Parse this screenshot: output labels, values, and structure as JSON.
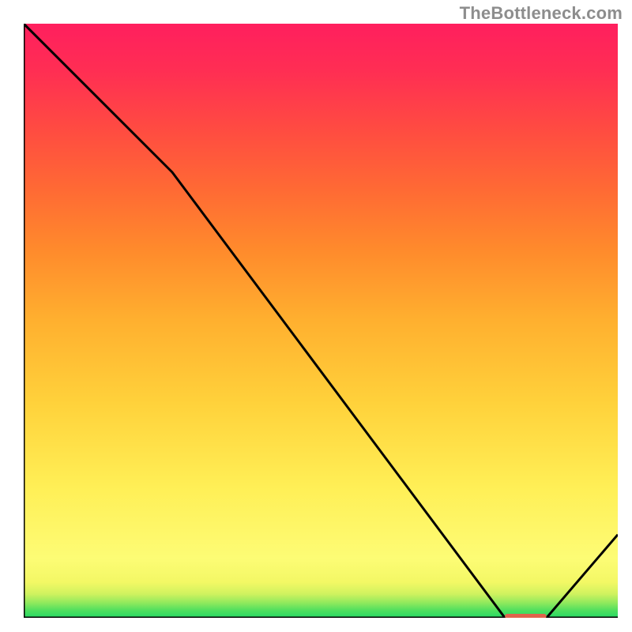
{
  "watermark_text": "TheBottleneck.com",
  "chart_data": {
    "type": "line",
    "title": "",
    "xlabel": "",
    "ylabel": "",
    "xlim": [
      0,
      100
    ],
    "ylim": [
      0,
      100
    ],
    "series": [
      {
        "name": "curve",
        "x": [
          0,
          25,
          81,
          88,
          100
        ],
        "y": [
          100,
          75,
          0,
          0,
          14
        ]
      }
    ],
    "annotations": [
      {
        "name": "min-marker",
        "x": 84.5,
        "y": 0,
        "width_pct": 7
      }
    ],
    "background_gradient": {
      "direction": "vertical",
      "stops": [
        {
          "pos": 0.0,
          "color": "#26d965"
        },
        {
          "pos": 0.06,
          "color": "#f3f865"
        },
        {
          "pos": 0.22,
          "color": "#ffef56"
        },
        {
          "pos": 0.5,
          "color": "#ffb02f"
        },
        {
          "pos": 0.82,
          "color": "#ff4c41"
        },
        {
          "pos": 1.0,
          "color": "#ff1f5e"
        }
      ]
    }
  }
}
